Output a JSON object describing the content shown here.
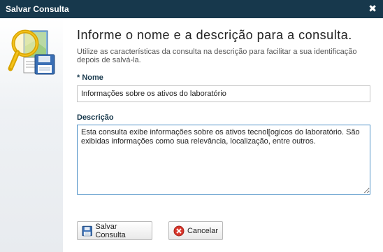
{
  "window": {
    "title": "Salvar Consulta",
    "close_glyph": "✖"
  },
  "form": {
    "heading": "Informe o nome e a descrição para a consulta.",
    "subtitle": "Utilize as características da consulta na descrição para facilitar a sua identificação depois de salvá-la.",
    "name_required_mark": "*",
    "name_label": "Nome",
    "name_value": "Informações sobre os ativos do laboratório",
    "description_label": "Descrição",
    "description_value": "Esta consulta exibe informações sobre os ativos tecnol[ogicos do laboratório. São exibidas informações como sua relevância, localização, entre outros. "
  },
  "buttons": {
    "save_label": "Salvar Consulta",
    "cancel_label": "Cancelar"
  },
  "icons": {
    "sidebar": "search-save-document-icon",
    "save": "floppy-disk-icon",
    "cancel": "cancel-circle-icon",
    "close": "close-icon"
  },
  "colors": {
    "titlebar": "#17384c",
    "label": "#17384c",
    "focus_border": "#4f92c7",
    "cancel_red": "#d9362b"
  }
}
